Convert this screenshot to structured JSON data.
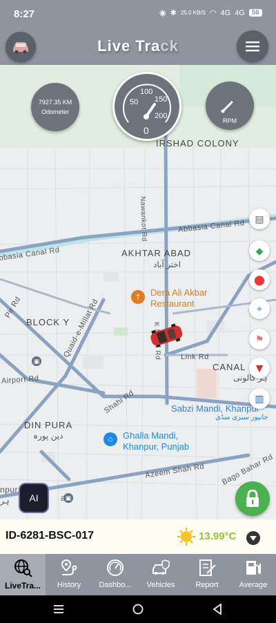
{
  "status_bar": {
    "time": "8:27",
    "net_speed": "25.0 KB/S",
    "signal1": "4G",
    "signal2": "4G",
    "battery": "56"
  },
  "app_bar": {
    "title_part1": "Live Tra",
    "title_part2": "ck"
  },
  "gauges": {
    "odometer_value": "7927.35 KM",
    "odometer_label": "Odometer",
    "speed_ticks": [
      "50",
      "100",
      "150",
      "200"
    ],
    "speed_value": "0",
    "rpm_label": "RPM"
  },
  "map": {
    "labels": {
      "irshad_colony": "IRSHAD COLONY",
      "nawankot_rd": "Nawankot Rd",
      "abbasia_canal_rd_1": "Abbasia Canal Rd",
      "abbasia_canal_rd_2": "bbasia Canal Rd",
      "akhtar_abad": "AKHTAR ABAD",
      "akhtar_abad_ur": "اختر آباد",
      "pir_rd": "Pir Rd",
      "block_y": "BLOCK Y",
      "quaid_rd": "Quaid-e-Millat Rd",
      "mehri_rd": "K Mehri Rd",
      "link_rd": "Link Rd",
      "canal_colony": "CANAL C",
      "canal_colony_ur": "ہر کالونی",
      "airport_rd": "Airport Rd",
      "shahi_rd": "Shahi Rd",
      "din_pura": "DIN PURA",
      "din_pura_ur": "دین پورہ",
      "azeem_shah_rd": "Azeem Shah Rd",
      "bago_bahar_rd": "Bago Bahar Rd",
      "nipur": "npur",
      "nipur_ur": "ہر",
      "way": "ay"
    },
    "pois": {
      "restaurant_line1": "Dera Ali Akbar",
      "restaurant_line2": "Restaurant",
      "sabzi_mandi": "Sabzi Mandi, Khanpur",
      "sabzi_mandi_ur": "خانپور سبزی منڈی",
      "ghalla_line1": "Ghalla Mandi,",
      "ghalla_line2": "Khanpur, Punjab"
    }
  },
  "ai_button": {
    "label": "AI"
  },
  "vehicle_bar": {
    "vehicle_id": "ID-6281-BSC-017",
    "temperature": "13.99°C"
  },
  "bottom_nav": {
    "items": [
      {
        "label": "LiveTra...",
        "icon": "globe-search-icon",
        "active": true
      },
      {
        "label": "History",
        "icon": "route-pin-icon",
        "active": false
      },
      {
        "label": "Dashbo...",
        "icon": "speedometer-icon",
        "active": false
      },
      {
        "label": "Vehicles",
        "icon": "car-shield-icon",
        "active": false
      },
      {
        "label": "Report",
        "icon": "report-icon",
        "active": false
      },
      {
        "label": "Average",
        "icon": "fuel-pump-icon",
        "active": false
      }
    ]
  },
  "colors": {
    "bar_gray": "#8f959e",
    "lock_green": "#4caf50",
    "temp_green": "#9bbf3a",
    "restaurant_orange": "#e07b1f",
    "poi_blue": "#1e88e5",
    "car_red": "#d32f2f"
  }
}
